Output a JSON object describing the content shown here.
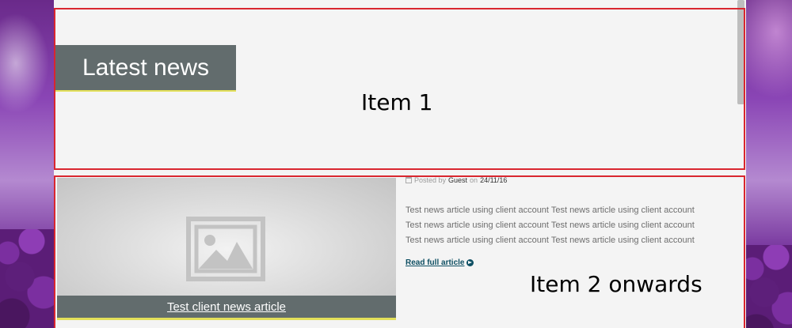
{
  "item1": {
    "heading": "Latest news",
    "annotation": "Item 1"
  },
  "item2": {
    "annotation": "Item 2 onwards",
    "article": {
      "image_icon": "image-placeholder-icon",
      "title": "Test client news article",
      "meta_prefix": "Posted by",
      "author": "Guest",
      "meta_on": "on",
      "date": "24/11/16",
      "excerpt_lines": [
        "Test news article using client account Test news article using client account",
        "Test news article using client account Test news article using client account",
        "Test news article using client account Test news article using client account"
      ],
      "read_more": "Read full article",
      "read_more_icon": "arrow-circle-right-icon"
    }
  },
  "colors": {
    "annotation_border": "#d9262f",
    "header_bg": "#626c6d",
    "accent_underline": "#e3e05a",
    "link": "#0e4f63"
  }
}
